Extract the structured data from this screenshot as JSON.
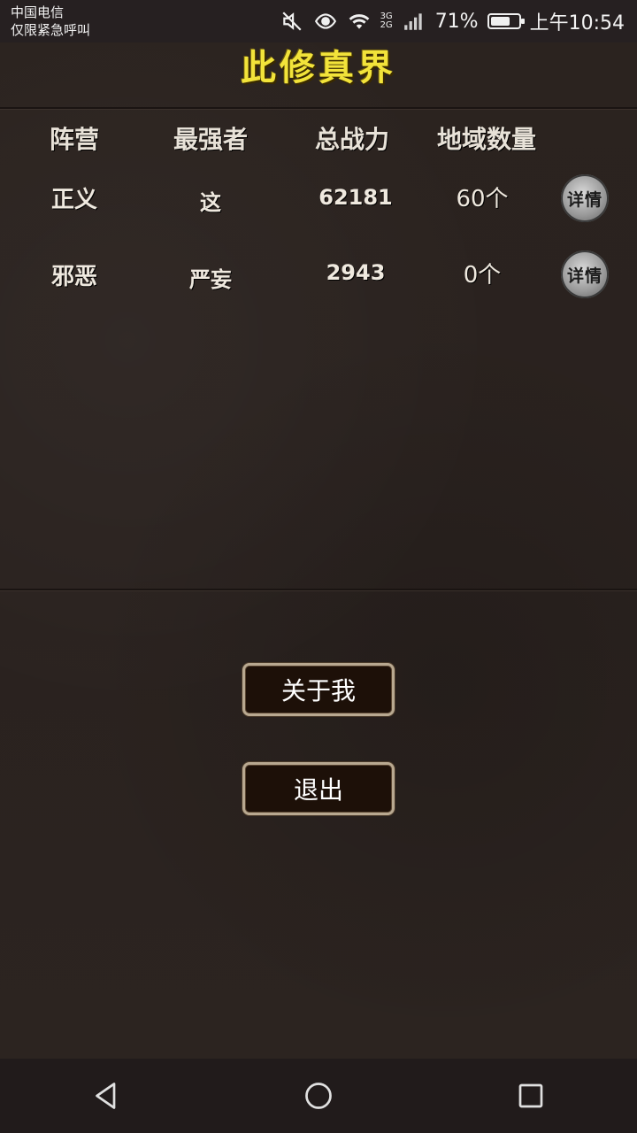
{
  "status_bar": {
    "carrier_line1": "中国电信",
    "carrier_line2": "仅限紧急呼叫",
    "net_top": "3G",
    "net_bottom": "2G",
    "battery_percent": "71%",
    "battery_level": 0.71,
    "time": "上午10:54"
  },
  "header": {
    "title": "此修真界"
  },
  "table": {
    "columns": [
      "阵营",
      "最强者",
      "总战力",
      "地域数量"
    ],
    "rows": [
      {
        "faction": "正义",
        "strongest": "这",
        "power": "62181",
        "regions": "60个",
        "detail_label": "详情"
      },
      {
        "faction": "邪恶",
        "strongest": "严妄",
        "power": "2943",
        "regions": "0个",
        "detail_label": "详情"
      }
    ]
  },
  "menu": {
    "about_label": "关于我",
    "exit_label": "退出"
  },
  "icons": {
    "mute": "mute-icon",
    "eye": "eye-icon",
    "wifi": "wifi-icon",
    "signal": "signal-icon",
    "battery": "battery-icon",
    "back": "back-icon",
    "home": "home-icon",
    "recents": "recents-icon"
  },
  "colors": {
    "title": "#f2e33a",
    "background": "#2a2220",
    "button_bg": "#1d1008",
    "button_border": "#b8a890"
  }
}
